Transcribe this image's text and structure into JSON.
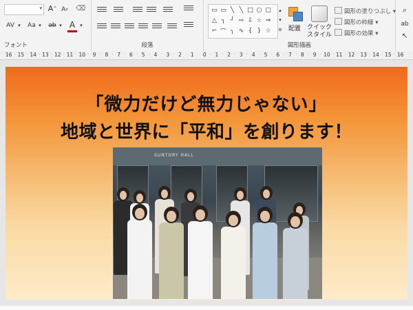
{
  "ribbon": {
    "groups": {
      "font": "フォント",
      "paragraph": "段落",
      "drawing": "図形描画"
    },
    "font": {
      "font_name": "",
      "grow_label": "A",
      "shrink_label": "A",
      "clear_icon": "clear-formatting-icon",
      "spacing_label": "AV",
      "case_label": "Aa",
      "highlight_label": "ab",
      "color_label": "A"
    },
    "drawing": {
      "arrange_label": "配置",
      "quick_style_label": "クイック\nスタイル",
      "fill_label": "図形の塗りつぶし",
      "outline_label": "図形の枠線",
      "effect_label": "図形の効果"
    }
  },
  "ruler": {
    "ticks": [
      "16",
      "15",
      "14",
      "13",
      "12",
      "11",
      "10",
      "9",
      "8",
      "7",
      "6",
      "5",
      "4",
      "3",
      "2",
      "1",
      "0",
      "1",
      "2",
      "3",
      "4",
      "5",
      "6",
      "7",
      "8",
      "9",
      "10",
      "11",
      "12",
      "13",
      "14",
      "15",
      "16"
    ]
  },
  "slide": {
    "title_line1": "「微力だけど無力じゃない」",
    "title_line2": "地域と世界に「平和」を創ります！",
    "photo_sign": "SUNTORY HALL",
    "gradient_top": "#f06a1c",
    "gradient_bottom": "#fdebc9"
  }
}
